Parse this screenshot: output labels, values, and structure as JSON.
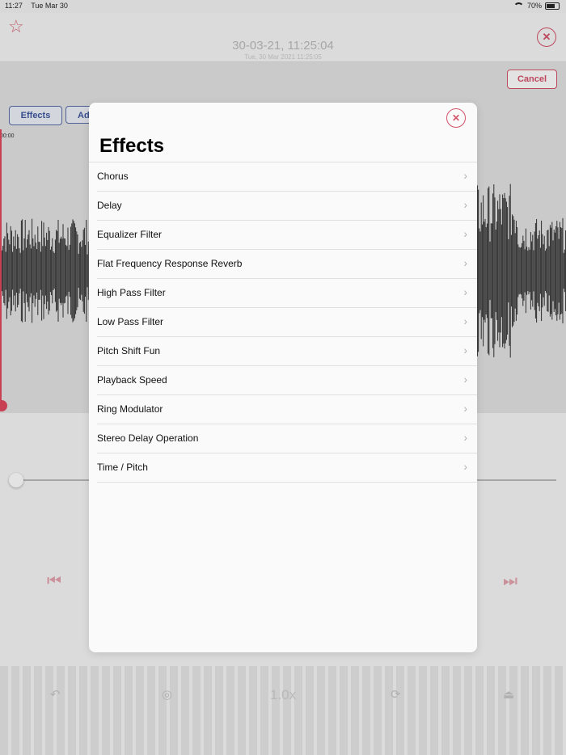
{
  "status": {
    "time": "11:27",
    "date": "Tue Mar 30",
    "battery": "70%"
  },
  "recording": {
    "title": "30-03-21, 11:25:04",
    "subtitle": "Tue, 30 Mar 2021 11:25:05"
  },
  "toolbar": {
    "cancel_label": "Cancel",
    "effects_tab_label": "Effects",
    "add_tab_label": "Ad"
  },
  "waveform": {
    "start_time": "00:00"
  },
  "playback": {
    "speed_label": "1.0x"
  },
  "modal": {
    "title": "Effects",
    "items": [
      {
        "label": "Chorus"
      },
      {
        "label": "Delay"
      },
      {
        "label": "Equalizer Filter"
      },
      {
        "label": "Flat Frequency Response Reverb"
      },
      {
        "label": "High Pass Filter"
      },
      {
        "label": "Low Pass Filter"
      },
      {
        "label": "Pitch Shift Fun"
      },
      {
        "label": "Playback Speed"
      },
      {
        "label": "Ring Modulator"
      },
      {
        "label": "Stereo Delay Operation"
      },
      {
        "label": "Time / Pitch"
      }
    ]
  },
  "colors": {
    "accent": "#d4536a",
    "tab": "#3e58a0",
    "playhead": "#e0485f"
  },
  "icons": [
    "star-icon",
    "close-icon",
    "chevron-right-icon",
    "skip-back-icon",
    "skip-forward-icon"
  ]
}
